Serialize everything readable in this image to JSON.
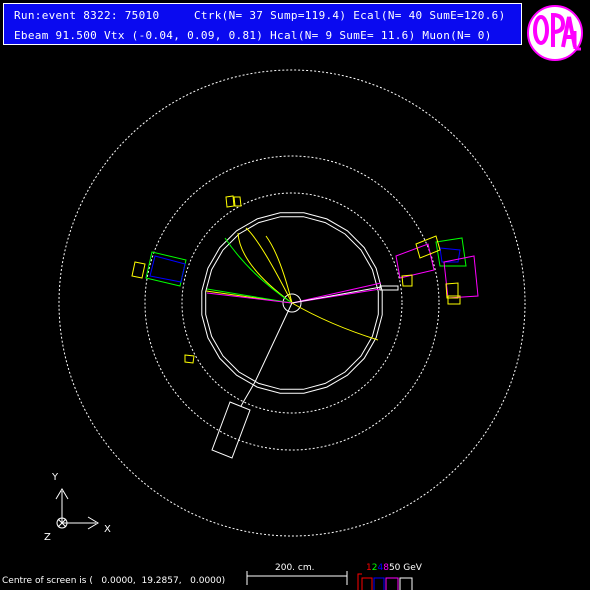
{
  "header": {
    "line1": "Run:event 8322: 75010     Ctrk(N= 37 Sump=119.4) Ecal(N= 40 SumE=120.6)",
    "line2": "Ebeam 91.500 Vtx (-0.04, 0.09, 0.81) Hcal(N= 9 SumE= 11.6) Muon(N= 0)"
  },
  "logo": {
    "text": "OPAL",
    "ring_color": "#ff00ff",
    "fill_color": "#ffffff"
  },
  "axes": {
    "y_label": "Y",
    "x_label": "X",
    "z_label": "Z"
  },
  "footer": {
    "centre_text": "Centre of screen is (   0.0000,  19.2857,   0.0000)",
    "scale_text": "200. cm.",
    "energy_scale": [
      {
        "label": "1",
        "color": "#ff0000"
      },
      {
        "label": "2",
        "color": "#00ff00"
      },
      {
        "label": "4",
        "color": "#0000ff"
      },
      {
        "label": "8",
        "color": "#ff00ff"
      },
      {
        "label": "50 GeV",
        "color": "#ffffff"
      }
    ]
  },
  "colors": {
    "background": "#000000",
    "header_bg": "#0a0af0",
    "detector": "#ffffff",
    "track_yellow": "#ffff00",
    "track_green": "#00ff00",
    "track_magenta": "#ff00ff",
    "track_blue": "#0000ff"
  }
}
